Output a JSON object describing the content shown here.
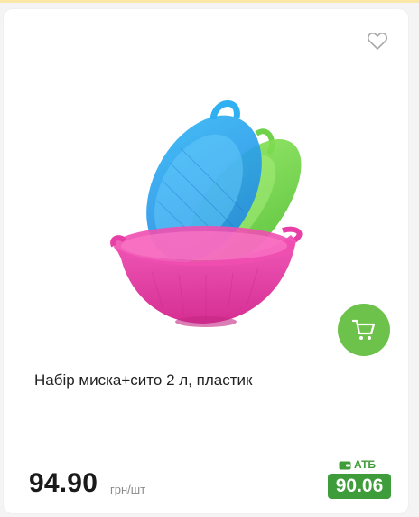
{
  "product": {
    "title": "Набір миска+сито 2 л, пластик",
    "price": "94.90",
    "unit": "грн/шт",
    "promo_label": "АТБ",
    "promo_price": "90.06"
  },
  "icons": {
    "favorite": "heart-icon",
    "cart": "cart-icon",
    "promo": "wallet-icon"
  },
  "colors": {
    "accent_green": "#6cc24a",
    "promo_green": "#3f9c3a",
    "bowl_pink": "#e83fa6",
    "sieve_blue": "#34a9f0",
    "sieve_green": "#7cd84c"
  }
}
